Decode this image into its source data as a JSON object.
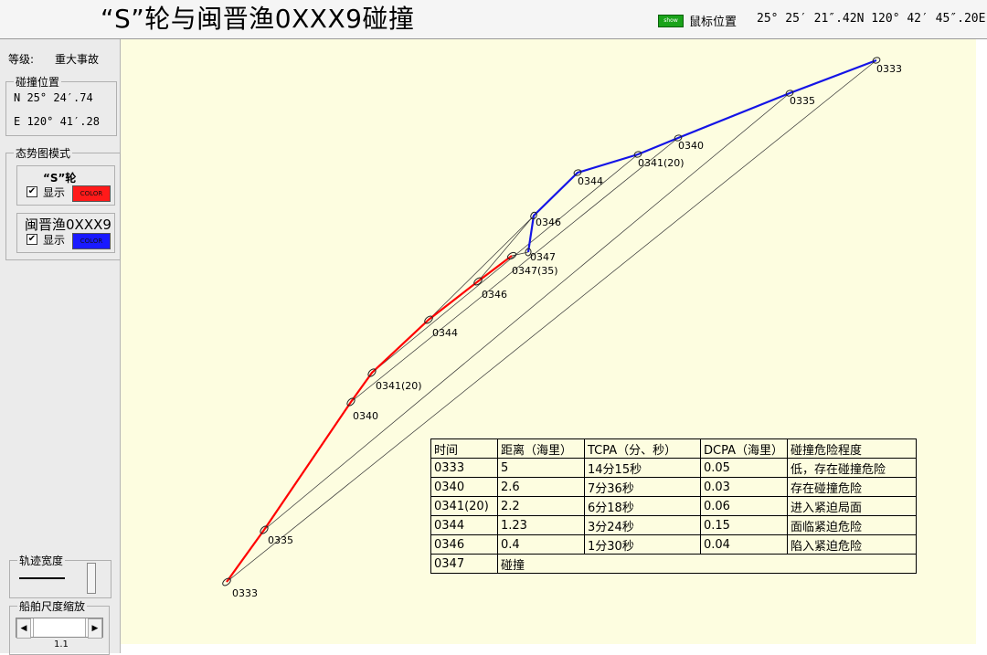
{
  "title": "“S”轮与闽晋渔0XXX9碰撞",
  "mouse": {
    "button_label": "show",
    "label": "鼠标位置",
    "coord": "25° 25′ 21″.42N 120° 42′ 45″.20E"
  },
  "panel": {
    "grade_label": "等级:",
    "grade_value": "重大事故",
    "collision_pos_title": "碰撞位置",
    "lat": "N 25° 24′.74",
    "lon": "E 120° 41′.28",
    "mode_title": "态势图模式",
    "ship1": {
      "name": "“S”轮",
      "show_label": "显示",
      "color_label": "COLOR",
      "color": "#ff1a1a",
      "checked": "✔"
    },
    "ship2": {
      "name": "闽晋渔0XXX9",
      "show_label": "显示",
      "color_label": "COLOR",
      "color": "#1a1aff",
      "checked": "✔"
    },
    "track_width_title": "轨迹宽度",
    "scale_title": "船舶尺度缩放",
    "scale_value": "1.1"
  },
  "map": {
    "red_labels": [
      "0333",
      "0335",
      "0340",
      "0341(20)",
      "0344",
      "0346"
    ],
    "blue_labels": [
      "0333",
      "0335",
      "0340",
      "0341(20)",
      "0344",
      "0346",
      "0347",
      "0347(35)"
    ],
    "colors": {
      "red_track": "#ff0000",
      "blue_track": "#1414e6",
      "background": "#fdfde0"
    }
  },
  "table": {
    "headers": [
      "时间",
      "距离（海里）",
      "TCPA（分、秒）",
      "DCPA（海里）",
      "碰撞危险程度"
    ],
    "rows": [
      [
        "0333",
        "5",
        "14分15秒",
        "0.05",
        "低，存在碰撞危险"
      ],
      [
        "0340",
        "2.6",
        "7分36秒",
        "0.03",
        "存在碰撞危险"
      ],
      [
        "0341(20)",
        "2.2",
        "6分18秒",
        "0.06",
        "进入紧迫局面"
      ],
      [
        "0344",
        "1.23",
        "3分24秒",
        "0.15",
        "面临紧迫危险"
      ],
      [
        "0346",
        "0.4",
        "1分30秒",
        "0.04",
        "陷入紧迫危险"
      ],
      [
        "0347",
        "碰撞",
        "",
        "",
        ""
      ]
    ]
  }
}
